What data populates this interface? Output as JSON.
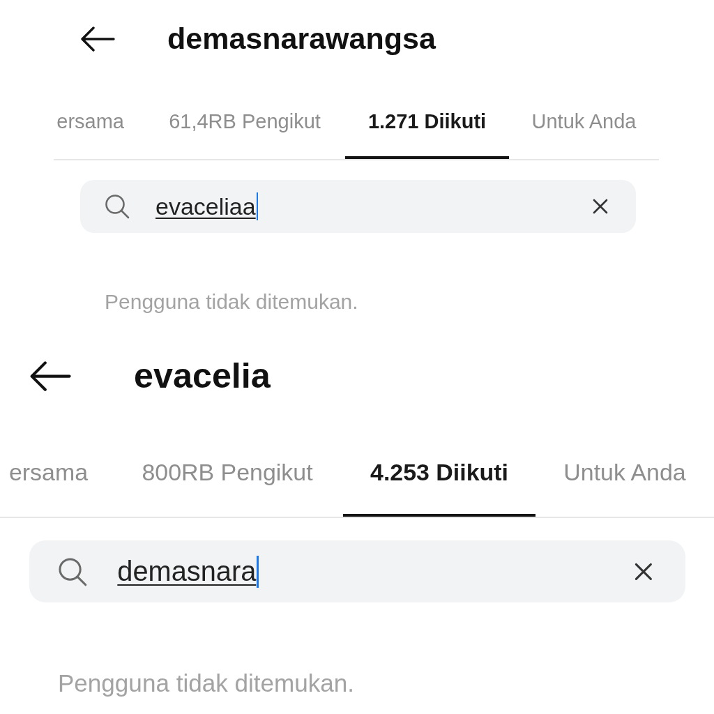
{
  "panels": [
    {
      "header": {
        "title": "demasnarawangsa"
      },
      "tabs": [
        {
          "label": "ersama",
          "selected": false
        },
        {
          "label": "61,4RB Pengikut",
          "selected": false
        },
        {
          "label": "1.271 Diikuti",
          "selected": true
        },
        {
          "label": "Untuk Anda",
          "selected": false
        }
      ],
      "search": {
        "value": "evaceliaa",
        "focused": true
      },
      "message": "Pengguna tidak ditemukan."
    },
    {
      "header": {
        "title": "evacelia"
      },
      "tabs": [
        {
          "label": "ersama",
          "selected": false
        },
        {
          "label": "800RB Pengikut",
          "selected": false
        },
        {
          "label": "4.253 Diikuti",
          "selected": true
        },
        {
          "label": "Untuk Anda",
          "selected": false
        }
      ],
      "search": {
        "value": "demasnara",
        "focused": true
      },
      "message": "Pengguna tidak ditemukan."
    }
  ]
}
